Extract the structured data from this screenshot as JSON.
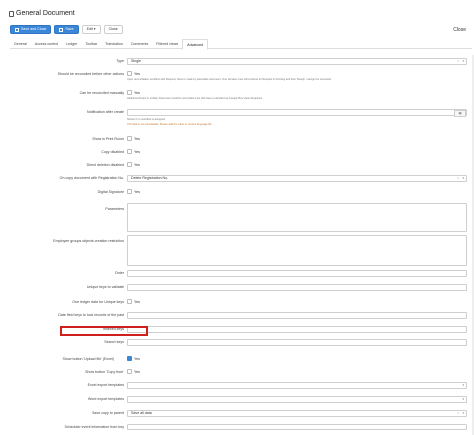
{
  "window": {
    "title": "General Document",
    "close_label": "Close"
  },
  "toolbar": {
    "save_close": "Save and Close",
    "save": "Save",
    "edit": "Edit ▾",
    "close": "Close"
  },
  "tabs": [
    "General",
    "Access control",
    "Ledger",
    "Toolbar",
    "Translation",
    "Comments",
    "Filtered views",
    "Advanced"
  ],
  "form": {
    "type": {
      "label": "Type",
      "value": "Single"
    },
    "reconciled": {
      "label": "Should be reconciled before other actions",
      "value": "Yes",
      "help": "Upon reconciliation workflow with Request: there is made by selectable document. One will also must will continue for Request in Pending and then 'Ready' / assign the reconciler."
    },
    "reconciled_manually": {
      "label": "Can be reconciled manually",
      "value": "Yes",
      "help": "Additional button in toolbar. Document could be reconciled once that have a standard as Google Plus Vision Required"
    },
    "notification": {
      "label": "Notification after create",
      "help1": "Shown if no workflow is assigned",
      "help2": "This field is not translatable. Please add the value to content language file"
    },
    "show_print": {
      "label": "Show in Print Room",
      "value": "Yes"
    },
    "copy_disabled": {
      "label": "Copy disabled",
      "value": "Yes"
    },
    "direct_deletion": {
      "label": "Direct deletion disabled",
      "value": "Yes"
    },
    "on_copy": {
      "label": "On copy document with Registration No.",
      "value": "Delete Registration No."
    },
    "digital_signature": {
      "label": "Digital Signature",
      "value": "Yes"
    },
    "parameters": {
      "label": "Parameters"
    },
    "employee_groups": {
      "label": "Employee groups objects creation restriction"
    },
    "order": {
      "label": "Order"
    },
    "unique_validate": {
      "label": "Unique keys to validate"
    },
    "one_ledger": {
      "label": "One ledger data for Unique keys",
      "value": "Yes"
    },
    "date_field": {
      "label": "Date field keys to lock records of the past"
    },
    "indexed_keys": {
      "label": "Indexed keys"
    },
    "search_keys": {
      "label": "Search keys"
    },
    "show_upload_excel": {
      "label": "Show button 'Upload file' (Excel)",
      "value": "Yes"
    },
    "show_copy_from": {
      "label": "Show button 'Copy from'",
      "value": "Yes"
    },
    "excel_templates": {
      "label": "Excel export templates"
    },
    "word_templates": {
      "label": "Word export templates"
    },
    "save_copy": {
      "label": "Save copy to parent",
      "value": "Save all data"
    },
    "scheduler": {
      "label": "Scheduler event information from key"
    }
  },
  "colors": {
    "primary": "#3a87d8",
    "highlight": "#d0201c"
  }
}
